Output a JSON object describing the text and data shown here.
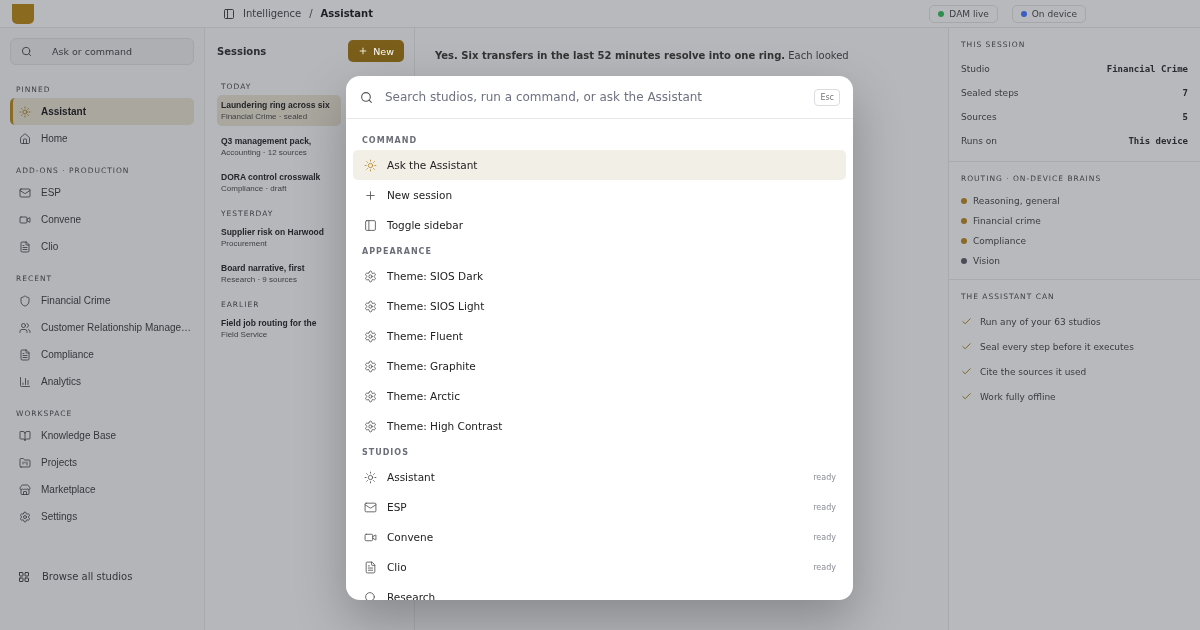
{
  "top_bar": {
    "breadcrumb": [
      "Intelligence",
      "Assistant"
    ],
    "separator": "/",
    "status_pills": [
      {
        "label": "DAM live",
        "color": "#2f8f4e"
      },
      {
        "label": "On device",
        "color": "#3b5fc0"
      }
    ]
  },
  "sidebar": {
    "search_placeholder": "Ask or command",
    "sections": [
      {
        "title": "PINNED",
        "items": [
          {
            "label": "Assistant",
            "kind": "sun",
            "selected": true
          },
          {
            "label": "Home",
            "kind": "home",
            "selected": false
          }
        ]
      },
      {
        "title": "ADD-ONS · PRODUCTION",
        "items": [
          {
            "label": "ESP",
            "kind": "mail",
            "selected": false
          },
          {
            "label": "Convene",
            "kind": "video",
            "selected": false
          },
          {
            "label": "Clio",
            "kind": "doc",
            "selected": false
          }
        ]
      },
      {
        "title": "RECENT",
        "items": [
          {
            "label": "Financial Crime",
            "kind": "shield",
            "selected": false
          },
          {
            "label": "Customer Relationship Manage…",
            "kind": "users",
            "selected": false
          },
          {
            "label": "Compliance",
            "kind": "doc",
            "selected": false
          },
          {
            "label": "Analytics",
            "kind": "chart",
            "selected": false
          }
        ]
      },
      {
        "title": "WORKSPACE",
        "items": [
          {
            "label": "Knowledge Base",
            "kind": "book",
            "selected": false
          },
          {
            "label": "Projects",
            "kind": "folder",
            "selected": false
          },
          {
            "label": "Marketplace",
            "kind": "store",
            "selected": false
          },
          {
            "label": "Settings",
            "kind": "gear",
            "selected": false
          }
        ]
      }
    ],
    "footer": "Browse all studios"
  },
  "sessions": {
    "title": "Sessions",
    "new_button": "New",
    "groups": [
      {
        "title": "TODAY",
        "items": [
          {
            "title": "Laundering ring across six",
            "meta": "Financial Crime · sealed",
            "selected": true
          },
          {
            "title": "Q3 management pack,",
            "meta": "Accounting · 12 sources",
            "selected": false
          },
          {
            "title": "DORA control crosswalk",
            "meta": "Compliance · draft",
            "selected": false
          }
        ]
      },
      {
        "title": "YESTERDAY",
        "items": [
          {
            "title": "Supplier risk on Harwood",
            "meta": "Procurement",
            "selected": false
          },
          {
            "title": "Board narrative, first",
            "meta": "Research · 9 sources",
            "selected": false
          }
        ]
      },
      {
        "title": "EARLIER",
        "items": [
          {
            "title": "Field job routing for the",
            "meta": "Field Service",
            "selected": false
          }
        ]
      }
    ]
  },
  "conversation": {
    "answer_lead": "Yes. Six transfers in the last 52 minutes resolve into one ring.",
    "answer_rest": "Each looked"
  },
  "details": {
    "session_title": "THIS SESSION",
    "session_rows": [
      {
        "label": "Studio",
        "value": "Financial Crime"
      },
      {
        "label": "Sealed steps",
        "value": "7"
      },
      {
        "label": "Sources",
        "value": "5"
      },
      {
        "label": "Runs on",
        "value": "This device"
      }
    ],
    "routing_title": "ROUTING · ON-DEVICE BRAINS",
    "routing": [
      {
        "label": "Reasoning, general",
        "color": "#8a6a26"
      },
      {
        "label": "Financial crime",
        "color": "#8a6a26"
      },
      {
        "label": "Compliance",
        "color": "#8a6a26"
      },
      {
        "label": "Vision",
        "color": "#4a4d58"
      }
    ],
    "abilities_title": "THE ASSISTANT CAN",
    "abilities": [
      "Run any of your 63 studios",
      "Seal every step before it executes",
      "Cite the sources it used",
      "Work fully offline"
    ]
  },
  "palette": {
    "placeholder": "Search studios, run a command, or ask the Assistant",
    "esc_key": "Esc",
    "sections": [
      {
        "title": "COMMAND",
        "items": [
          {
            "label": "Ask the Assistant",
            "kind": "sun",
            "selected": true
          },
          {
            "label": "New session",
            "kind": "plus",
            "selected": false
          },
          {
            "label": "Toggle sidebar",
            "kind": "sidebar",
            "selected": false
          }
        ]
      },
      {
        "title": "APPEARANCE",
        "items": [
          {
            "label": "Theme: SIOS Dark",
            "kind": "gear",
            "selected": false
          },
          {
            "label": "Theme: SIOS Light",
            "kind": "gear",
            "selected": false
          },
          {
            "label": "Theme: Fluent",
            "kind": "gear",
            "selected": false
          },
          {
            "label": "Theme: Graphite",
            "kind": "gear",
            "selected": false
          },
          {
            "label": "Theme: Arctic",
            "kind": "gear",
            "selected": false
          },
          {
            "label": "Theme: High Contrast",
            "kind": "gear",
            "selected": false
          }
        ]
      },
      {
        "title": "STUDIOS",
        "items": [
          {
            "label": "Assistant",
            "kind": "sun",
            "status": "ready",
            "selected": false
          },
          {
            "label": "ESP",
            "kind": "mail",
            "status": "ready",
            "selected": false
          },
          {
            "label": "Convene",
            "kind": "video",
            "status": "ready",
            "selected": false
          },
          {
            "label": "Clio",
            "kind": "doc",
            "status": "ready",
            "selected": false
          },
          {
            "label": "Research",
            "kind": "search",
            "selected": false
          }
        ]
      }
    ]
  }
}
